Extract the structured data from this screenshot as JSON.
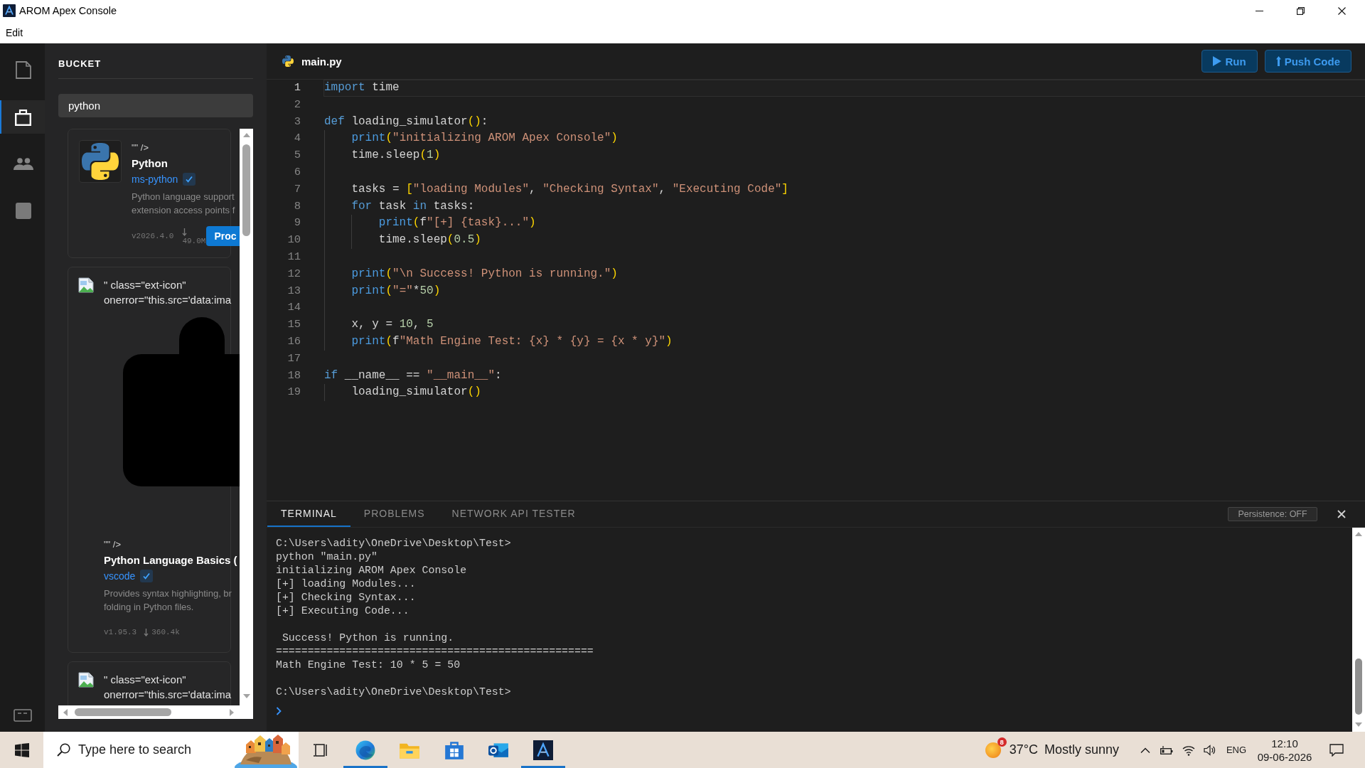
{
  "window": {
    "title": "AROM Apex Console"
  },
  "menu": [
    "Edit"
  ],
  "activity_bar": {
    "items": [
      {
        "kind": "file",
        "selected": false
      },
      {
        "kind": "bag",
        "selected": true
      },
      {
        "kind": "people",
        "selected": false
      },
      {
        "kind": "square",
        "selected": false
      }
    ]
  },
  "sidebar": {
    "title": "BUCKET",
    "search": {
      "value": "python"
    },
    "extensions": [
      {
        "kind": "logo",
        "markup": "\"\" />",
        "name": "Python",
        "publisher": "ms-python",
        "verified": true,
        "description": "Python language support\nextension access points f",
        "version": "v2026.4.0",
        "downloads": "49.0M",
        "button": "Proc"
      },
      {
        "kind": "broken",
        "alt": "\" class=\"ext-icon\"\nonerror=\"this.src='data:ima",
        "graphic": true,
        "markup": "\"\" />",
        "name": "Python Language Basics (",
        "publisher": "vscode",
        "verified": true,
        "description": "Provides syntax highlighting, br\nfolding in Python files.",
        "version": "v1.95.3",
        "downloads": "360.4k"
      },
      {
        "kind": "broken",
        "alt": "\" class=\"ext-icon\"\nonerror=\"this.src='data:ima"
      }
    ]
  },
  "editor": {
    "tab": "main.py",
    "actions": [
      {
        "kind": "run",
        "label": "Run"
      },
      {
        "kind": "push",
        "label": "Push Code"
      }
    ],
    "lines": [
      {
        "n": "1",
        "current": true,
        "tokens": [
          {
            "kind": "keyword",
            "text": "import"
          },
          {
            "kind": "plain",
            "text": " time"
          }
        ]
      },
      {
        "n": "2",
        "current": false
      },
      {
        "n": "3",
        "current": false,
        "tokens": [
          {
            "kind": "keyword",
            "text": "def"
          },
          {
            "kind": "plain",
            "text": " loading_simulator"
          },
          {
            "kind": "bracket",
            "text": "()"
          },
          {
            "kind": "plain",
            "text": ":"
          }
        ]
      },
      {
        "n": "4",
        "current": false,
        "tokens": [
          {
            "kind": "builtin",
            "text": "    print"
          },
          {
            "kind": "bracket",
            "text": "("
          },
          {
            "kind": "string",
            "text": "\"initializing AROM Apex Console\""
          },
          {
            "kind": "bracket",
            "text": ")"
          }
        ]
      },
      {
        "n": "5",
        "current": false,
        "tokens": [
          {
            "kind": "plain",
            "text": "    time.sleep"
          },
          {
            "kind": "bracket",
            "text": "("
          },
          {
            "kind": "number",
            "text": "1"
          },
          {
            "kind": "bracket",
            "text": ")"
          }
        ]
      },
      {
        "n": "6",
        "current": false
      },
      {
        "n": "7",
        "current": false,
        "tokens": [
          {
            "kind": "plain",
            "text": "    tasks = "
          },
          {
            "kind": "bracket",
            "text": "["
          },
          {
            "kind": "string",
            "text": "\"loading Modules\""
          },
          {
            "kind": "plain",
            "text": ", "
          },
          {
            "kind": "string",
            "text": "\"Checking Syntax\""
          },
          {
            "kind": "plain",
            "text": ", "
          },
          {
            "kind": "string",
            "text": "\"Executing Code\""
          },
          {
            "kind": "bracket",
            "text": "]"
          }
        ]
      },
      {
        "n": "8",
        "current": false,
        "tokens": [
          {
            "kind": "keyword",
            "text": "    for"
          },
          {
            "kind": "plain",
            "text": " task "
          },
          {
            "kind": "keyword",
            "text": "in"
          },
          {
            "kind": "plain",
            "text": " tasks:"
          }
        ]
      },
      {
        "n": "9",
        "current": false,
        "tokens": [
          {
            "kind": "builtin",
            "text": "        print"
          },
          {
            "kind": "bracket",
            "text": "("
          },
          {
            "kind": "plain",
            "text": "f"
          },
          {
            "kind": "string",
            "text": "\"[+] {task}...\""
          },
          {
            "kind": "bracket",
            "text": ")"
          }
        ]
      },
      {
        "n": "10",
        "current": false,
        "tokens": [
          {
            "kind": "plain",
            "text": "        time.sleep"
          },
          {
            "kind": "bracket",
            "text": "("
          },
          {
            "kind": "number",
            "text": "0.5"
          },
          {
            "kind": "bracket",
            "text": ")"
          }
        ]
      },
      {
        "n": "11",
        "current": false
      },
      {
        "n": "12",
        "current": false,
        "tokens": [
          {
            "kind": "builtin",
            "text": "    print"
          },
          {
            "kind": "bracket",
            "text": "("
          },
          {
            "kind": "string",
            "text": "\"\\n Success! Python is running.\""
          },
          {
            "kind": "bracket",
            "text": ")"
          }
        ]
      },
      {
        "n": "13",
        "current": false,
        "tokens": [
          {
            "kind": "builtin",
            "text": "    print"
          },
          {
            "kind": "bracket",
            "text": "("
          },
          {
            "kind": "string",
            "text": "\"=\""
          },
          {
            "kind": "plain",
            "text": "*"
          },
          {
            "kind": "number",
            "text": "50"
          },
          {
            "kind": "bracket",
            "text": ")"
          }
        ]
      },
      {
        "n": "14",
        "current": false
      },
      {
        "n": "15",
        "current": false,
        "tokens": [
          {
            "kind": "plain",
            "text": "    x, y = "
          },
          {
            "kind": "number",
            "text": "10"
          },
          {
            "kind": "plain",
            "text": ", "
          },
          {
            "kind": "number",
            "text": "5"
          }
        ]
      },
      {
        "n": "16",
        "current": false,
        "tokens": [
          {
            "kind": "builtin",
            "text": "    print"
          },
          {
            "kind": "bracket",
            "text": "("
          },
          {
            "kind": "plain",
            "text": "f"
          },
          {
            "kind": "string",
            "text": "\"Math Engine Test: {x} * {y} = {x * y}\""
          },
          {
            "kind": "bracket",
            "text": ")"
          }
        ]
      },
      {
        "n": "17",
        "current": false
      },
      {
        "n": "18",
        "current": false,
        "tokens": [
          {
            "kind": "keyword",
            "text": "if"
          },
          {
            "kind": "plain",
            "text": " __name__ == "
          },
          {
            "kind": "string",
            "text": "\"__main__\""
          },
          {
            "kind": "plain",
            "text": ":"
          }
        ]
      },
      {
        "n": "19",
        "current": false,
        "tokens": [
          {
            "kind": "plain",
            "text": "    loading_simulator"
          },
          {
            "kind": "bracket",
            "text": "()"
          }
        ]
      }
    ]
  },
  "panel": {
    "tabs": [
      {
        "label": "TERMINAL",
        "selected": true
      },
      {
        "label": "PROBLEMS",
        "selected": false
      },
      {
        "label": "NETWORK API TESTER",
        "selected": false
      }
    ],
    "persistence": "Persistence: OFF",
    "terminal": {
      "output": "C:\\Users\\adity\\OneDrive\\Desktop\\Test>\npython \"main.py\"\ninitializing AROM Apex Console\n[+] loading Modules...\n[+] Checking Syntax...\n[+] Executing Code...\n\n Success! Python is running.\n==================================================\nMath Engine Test: 10 * 5 = 50\n\nC:\\Users\\adity\\OneDrive\\Desktop\\Test>"
    }
  },
  "taskbar": {
    "search": {
      "placeholder": "Type here to search"
    },
    "apps": [
      {
        "kind": "task-view",
        "running": false
      },
      {
        "kind": "browser",
        "running": true
      },
      {
        "kind": "folder",
        "running": false
      },
      {
        "kind": "store",
        "running": false
      },
      {
        "kind": "mail",
        "running": false
      },
      {
        "kind": "app",
        "running": true
      }
    ],
    "weather": {
      "badge": "8",
      "temperature": "37°C",
      "condition": "Mostly sunny"
    },
    "language": "ENG",
    "time": "12:10",
    "date": "09-06-2026"
  }
}
